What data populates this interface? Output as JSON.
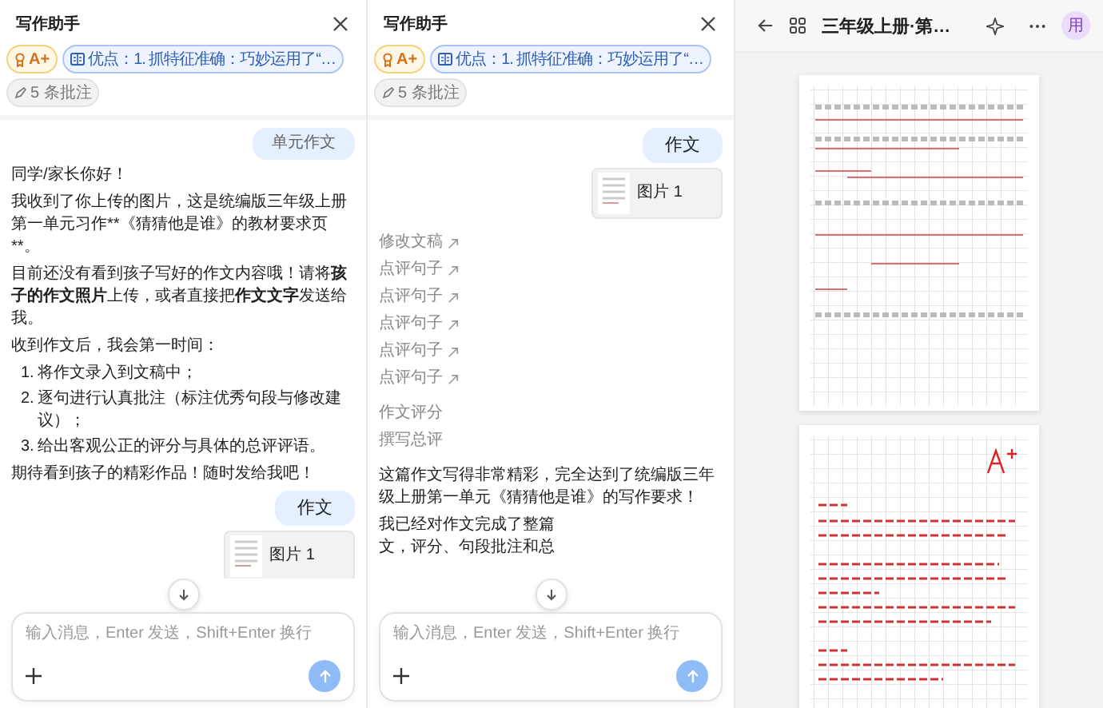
{
  "panels": [
    {
      "title": "写作助手",
      "grade": "A+",
      "highlight": "优点：1. 抓特征准确：巧妙运用了“…",
      "annotations": "5 条批注",
      "messages": [
        {
          "kind": "small_bubble",
          "text": "单元作文"
        },
        {
          "kind": "text",
          "text": "同学/家长你好！"
        },
        {
          "kind": "plain_text",
          "text": "我收到了你上传的图片，这是统编版三年级上册第一单元习作**《猜猜他是谁》的教材要求页**。"
        },
        {
          "kind": "text",
          "text": "目前还没有看到孩子写好的作文内容哦！请将**孩子的作文照片**上传，或者直接把**作文文字**发送给我。"
        },
        {
          "kind": "text",
          "text": "收到作文后，我会第一时间："
        },
        {
          "kind": "list",
          "items": [
            {
              "number": "1.",
              "text": "将作文录入到文稿中；"
            },
            {
              "number": "2.",
              "text": "逐句进行认真批注（标注优秀句段与修改建议）；"
            },
            {
              "number": "3.",
              "text": "给出客观公正的评分与具体的总评评语。"
            }
          ]
        },
        {
          "kind": "text",
          "text": "期待看到孩子的精彩作品！随时发给我吧！"
        },
        {
          "kind": "bubble",
          "text": "作文"
        },
        {
          "kind": "image_card",
          "text": "图片 1"
        }
      ],
      "placeholder": "输入消息，Enter 发送，Shift+Enter 换行"
    },
    {
      "title": "写作助手",
      "grade": "A+",
      "highlight": "优点：1. 抓特征准确：巧妙运用了“…",
      "annotations": "5 条批注",
      "messages": [
        {
          "kind": "bubble",
          "text": "作文"
        },
        {
          "kind": "image_card",
          "text": "图片 1"
        },
        {
          "kind": "link",
          "text": "修改文稿"
        },
        {
          "kind": "link",
          "text": "点评句子"
        },
        {
          "kind": "link",
          "text": "点评句子"
        },
        {
          "kind": "link",
          "text": "点评句子"
        },
        {
          "kind": "link",
          "text": "点评句子"
        },
        {
          "kind": "link",
          "text": "点评句子"
        },
        {
          "kind": "step",
          "text": "作文评分"
        },
        {
          "kind": "step",
          "text": "撰写总评"
        },
        {
          "kind": "text",
          "text": "这篇作文写得非常精彩，完全达到了统编版三年级上册第一单元《猜猜他是谁》的写作要求！"
        },
        {
          "kind": "covered_text",
          "parts": [
            "我已经对作文完成了整篇",
            "文，评分、句段批注和总"
          ]
        }
      ],
      "placeholder": "输入消息，Enter 发送，Shift+Enter 换行"
    }
  ],
  "viewer": {
    "title": "三年级上册·第…",
    "avatar": "用"
  }
}
